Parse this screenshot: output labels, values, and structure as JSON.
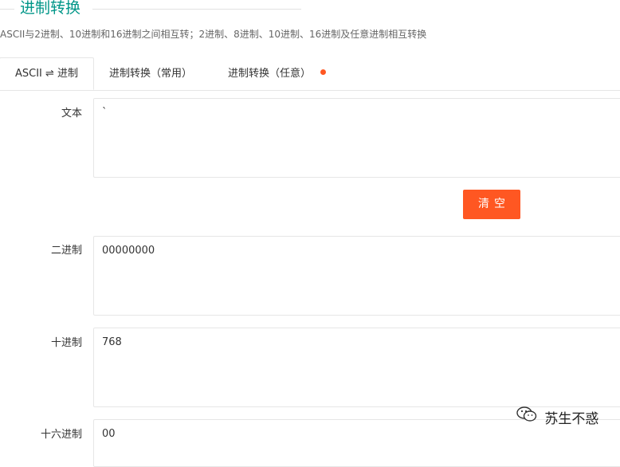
{
  "header": {
    "title": "进制转换",
    "subtitle": "ASCII与2进制、10进制和16进制之间相互转；2进制、8进制、10进制、16进制及任意进制相互转换"
  },
  "tabs": [
    {
      "label": "ASCII ⇌ 进制",
      "active": true
    },
    {
      "label": "进制转换（常用）",
      "active": false
    },
    {
      "label": "进制转换（任意）",
      "active": false,
      "badge": "dot"
    }
  ],
  "form": {
    "text": {
      "label": "文本",
      "value": "`"
    },
    "clear_button": "清空",
    "binary": {
      "label": "二进制",
      "value": "00000000"
    },
    "decimal": {
      "label": "十进制",
      "value": "768"
    },
    "hex": {
      "label": "十六进制",
      "value": "00"
    }
  },
  "watermark": {
    "text": "苏生不惑",
    "icon": "wechat-icon"
  },
  "colors": {
    "accent": "#009688",
    "button": "#ff5722",
    "border": "#e6e6e6"
  }
}
